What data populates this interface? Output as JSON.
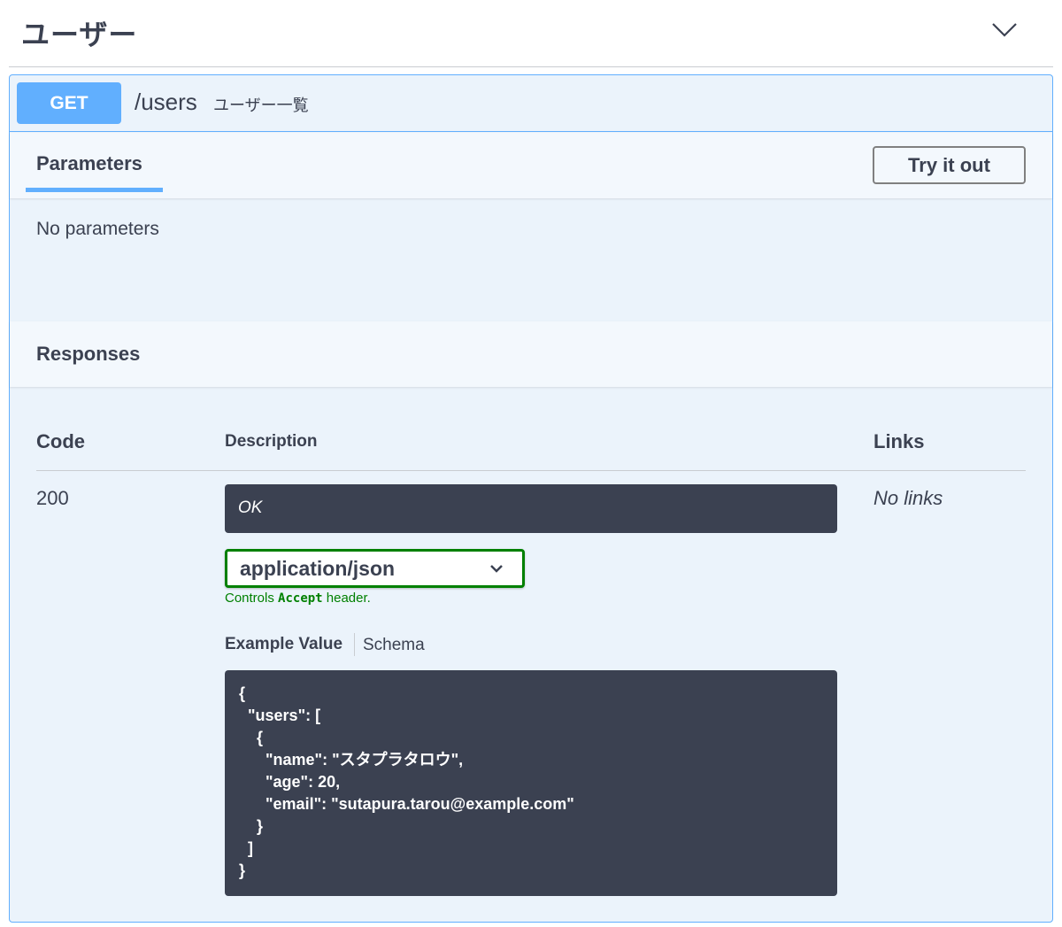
{
  "tag": {
    "title": "ユーザー"
  },
  "operation": {
    "method": "GET",
    "path": "/users",
    "summary": "ユーザー一覧"
  },
  "parameters": {
    "tab_label": "Parameters",
    "try_button": "Try it out",
    "empty_text": "No parameters"
  },
  "responses": {
    "title": "Responses",
    "headers": {
      "code": "Code",
      "description": "Description",
      "links": "Links"
    },
    "rows": [
      {
        "code": "200",
        "description": "OK",
        "links": "No links",
        "media_type": "application/json",
        "controls_prefix": "Controls ",
        "controls_code": "Accept",
        "controls_suffix": " header.",
        "example_tab": "Example Value",
        "schema_tab": "Schema",
        "example_lines": [
          "{",
          "  \"users\": [",
          "    {",
          "      \"name\": \"スタプラタロウ\",",
          "      \"age\": 20,",
          "      \"email\": \"sutapura.tarou@example.com\"",
          "    }",
          "  ]",
          "}"
        ]
      }
    ]
  },
  "icons": {
    "collapse": "chevron-down-icon",
    "select": "chevron-down-icon"
  },
  "colors": {
    "get_method": "#61affe",
    "border": "#61affe",
    "panel_bg": "#ebf3fb",
    "code_bg": "#3b4151",
    "select_border": "#008000"
  }
}
